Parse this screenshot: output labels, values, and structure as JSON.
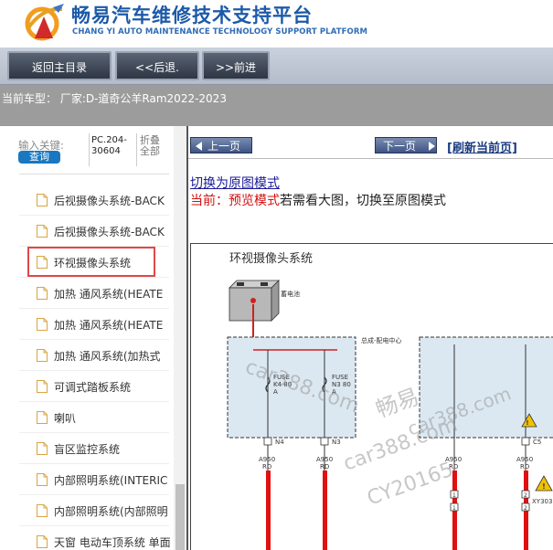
{
  "header": {
    "title": "畅易汽车维修技术支持平台",
    "subtitle": "CHANG YI AUTO MAINTENANCE TECHNOLOGY SUPPORT PLATFORM"
  },
  "toolbar": {
    "home_label": "返回主目录",
    "back_label": "<<后退.",
    "forward_label": ">>前进"
  },
  "car_bar": {
    "text": "当前车型： 厂家:D-道奇公羊Ram2022-2023"
  },
  "sidebar": {
    "search_label": "输入关键:",
    "search_button": "查询",
    "code_line1": "PC.204-",
    "code_line2": "30604",
    "fold_line1": "折叠",
    "fold_line2": "全部",
    "items": [
      {
        "label": "后视摄像头系统-BACK"
      },
      {
        "label": "后视摄像头系统-BACK"
      },
      {
        "label": "环视摄像头系统"
      },
      {
        "label": "加热 通风系统(HEATE"
      },
      {
        "label": "加热 通风系统(HEATE"
      },
      {
        "label": "加热 通风系统(加热式"
      },
      {
        "label": "可调式踏板系统"
      },
      {
        "label": "喇叭"
      },
      {
        "label": "盲区监控系统"
      },
      {
        "label": "内部照明系统(INTERIC"
      },
      {
        "label": "内部照明系统(内部照明"
      },
      {
        "label": "天窗 电动车顶系统 单面"
      }
    ],
    "selected_index": 2
  },
  "content": {
    "prev_label": "上一页",
    "next_label": "下一页",
    "refresh_label": "[刷新当前页]",
    "switch_link": "切换为原图模式",
    "status_prefix": "当前：",
    "status_mode": "预览模式",
    "status_suffix": "若需看大图，切换至原图模式"
  },
  "diagram": {
    "title": "环视摄像头系统",
    "battery_label": "蓄电池",
    "pdc_label": "总成-配电中心",
    "fuse1_l1": "FUSE",
    "fuse1_l2": "K4 80",
    "fuse1_l3": "A",
    "fuse2_l1": "FUSE",
    "fuse2_l2": "N3 80",
    "fuse2_l3": "A",
    "pin_n4": "N4",
    "pin_n3": "N3",
    "pin_c5": "C5",
    "wire1_l1": "A950",
    "wire1_l2": "RD",
    "wire2_l1": "A950",
    "wire2_l2": "RD",
    "wire3_l1": "A950",
    "wire3_l2": "RD",
    "wire4_l1": "A950",
    "wire4_l2": "RD",
    "connector_label": "XY303",
    "pin_1a": "1",
    "pin_2a": "2",
    "pin_1b": "1",
    "pin_2b": "2",
    "watermark1": "car388.com",
    "watermark2": "畅易",
    "watermark3": "car388.com",
    "watermark4": "CY20165",
    "watermark5": "car388.com"
  }
}
